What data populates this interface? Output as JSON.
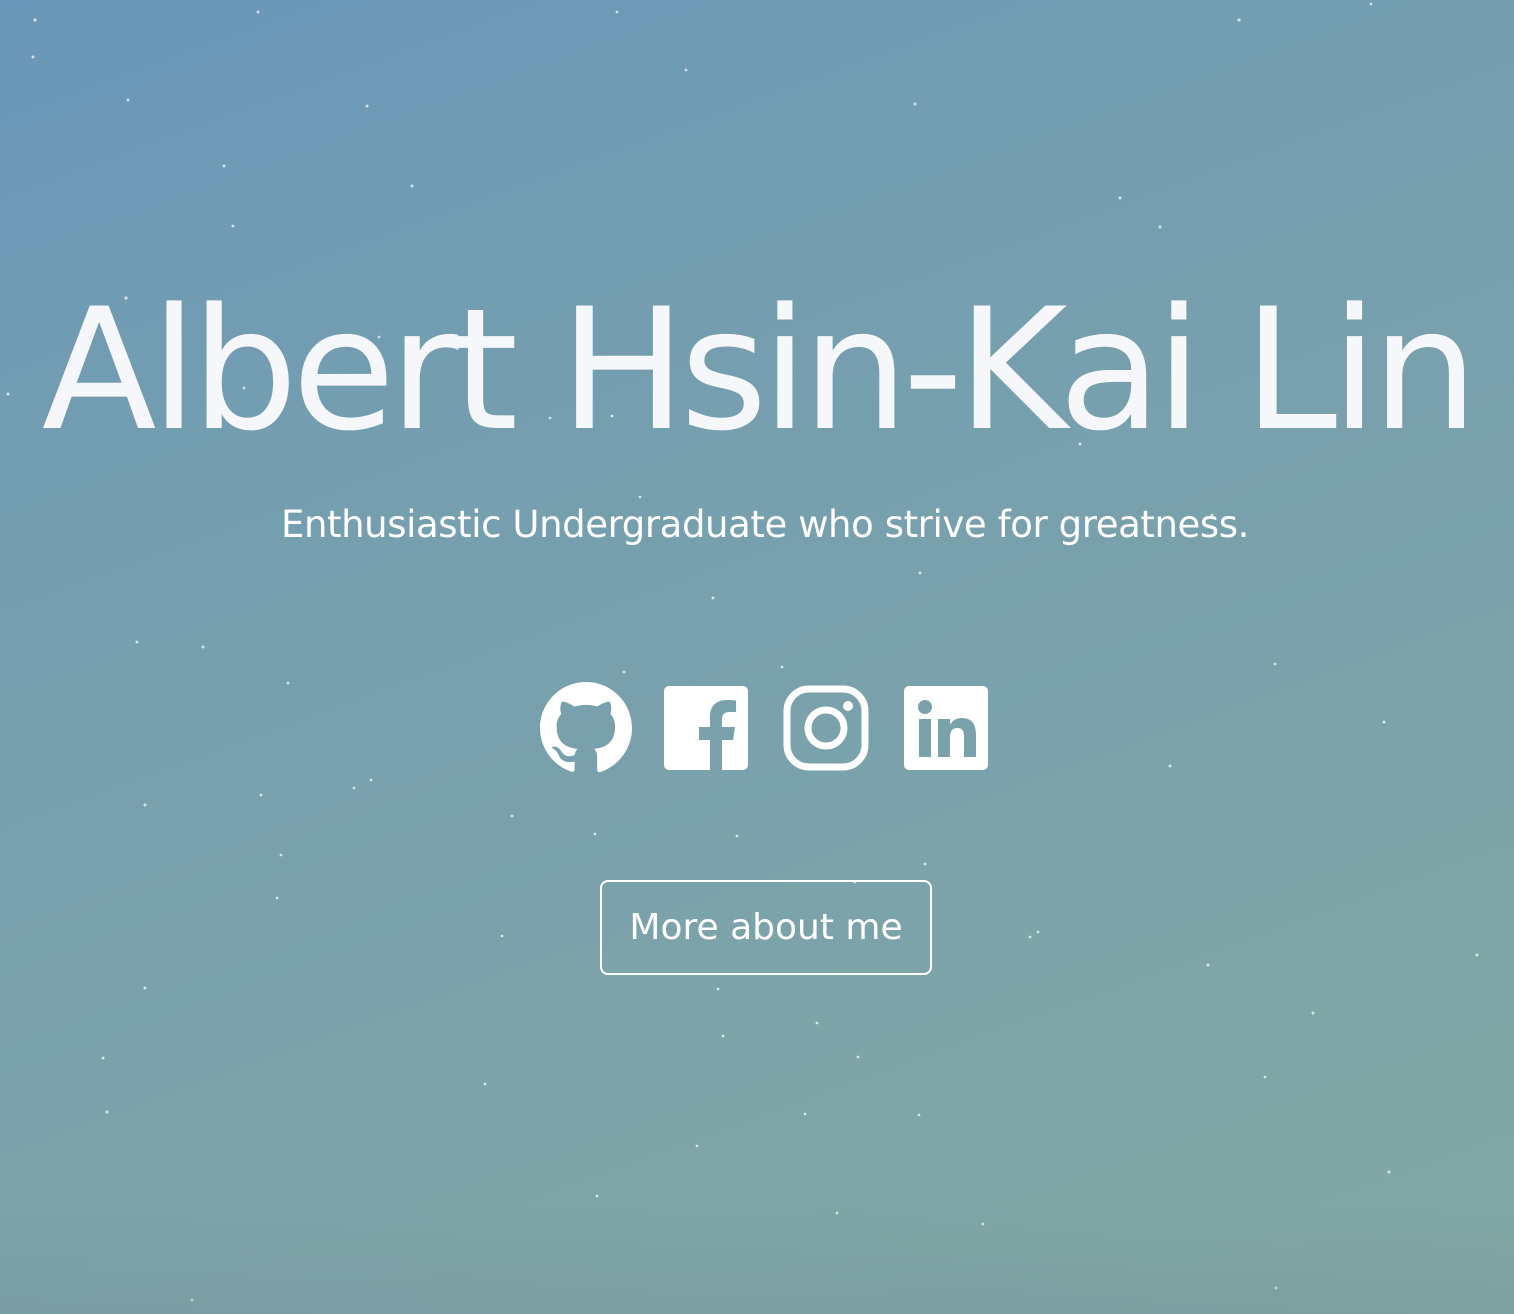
{
  "hero": {
    "name": "Albert Hsin-Kai Lin",
    "tagline": "Enthusiastic Undergraduate who strive for greatness.",
    "background_colors": [
      "#6a97b9",
      "#82a9a3"
    ],
    "text_color": "#ffffff"
  },
  "socials": [
    {
      "icon": "github-icon"
    },
    {
      "icon": "facebook-icon"
    },
    {
      "icon": "instagram-icon"
    },
    {
      "icon": "linkedin-icon"
    }
  ],
  "cta": {
    "label": "More about me"
  }
}
